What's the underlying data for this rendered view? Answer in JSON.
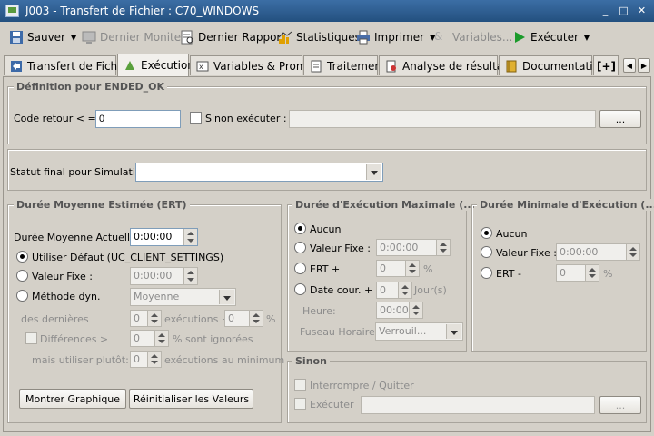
{
  "window": {
    "title": "J003 - Transfert de Fichier : C70_WINDOWS",
    "min": "_",
    "max": "□",
    "close": "✕"
  },
  "toolbar": {
    "save": "Sauver",
    "last_monitor": "Dernier Moniteur",
    "last_report": "Dernier Rapport",
    "stats": "Statistiques",
    "print": "Imprimer",
    "variables": "Variables...",
    "execute": "Exécuter"
  },
  "tabs": [
    "Transfert de Fichier",
    "Exécution",
    "Variables & Prompts",
    "Traitement",
    "Analyse de résultats",
    "Documentation"
  ],
  "tab_more": "[+]",
  "definition": {
    "title": "Définition pour ENDED_OK",
    "code_label": "Code retour < =:",
    "code_value": "0",
    "else_label": "Sinon exécuter :",
    "browse": "..."
  },
  "status": {
    "label": "Statut final pour Simulation:",
    "value": ""
  },
  "ert": {
    "title": "Durée Moyenne Estimée (ERT)",
    "current_label": "Durée Moyenne Actuelle:",
    "current_value": "0:00:00",
    "default_label": "Utiliser Défaut (UC_CLIENT_SETTINGS)",
    "fixed_label": "Valeur Fixe :",
    "fixed_value": "0:00:00",
    "method_label": "Méthode dyn.",
    "method_value": "Moyenne",
    "last_label": "des dernières",
    "last_value": "0",
    "exec_plus": "exécutions +",
    "pct_value": "0",
    "pct": "%",
    "diff_label": "Différences >",
    "diff_value": "0",
    "ignored": "% sont ignorées",
    "rather_label": "mais utiliser plutôt:",
    "rather_value": "0",
    "min_exec": "exécutions au minimum",
    "show_graph": "Montrer Graphique",
    "reset": "Réinitialiser les Valeurs"
  },
  "max": {
    "title": "Durée d'Exécution Maximale (...",
    "none": "Aucun",
    "fixed_label": "Valeur Fixe :",
    "fixed_value": "0:00:00",
    "ert_label": "ERT +",
    "ert_value": "0",
    "pct": "%",
    "date_label": "Date cour. +",
    "date_value": "0",
    "days": "Jour(s)",
    "hour_label": "Heure:",
    "hour_value": "00:00",
    "tz_label": "Fuseau Horaire:",
    "tz_value": "Verrouil..."
  },
  "min": {
    "title": "Durée Minimale d'Exécution (...",
    "none": "Aucun",
    "fixed_label": "Valeur Fixe :",
    "fixed_value": "0:00:00",
    "ert_label": "ERT -",
    "ert_value": "0",
    "pct": "%"
  },
  "sinon": {
    "title": "Sinon",
    "abort": "Interrompre / Quitter",
    "execute": "Exécuter",
    "browse": "..."
  }
}
